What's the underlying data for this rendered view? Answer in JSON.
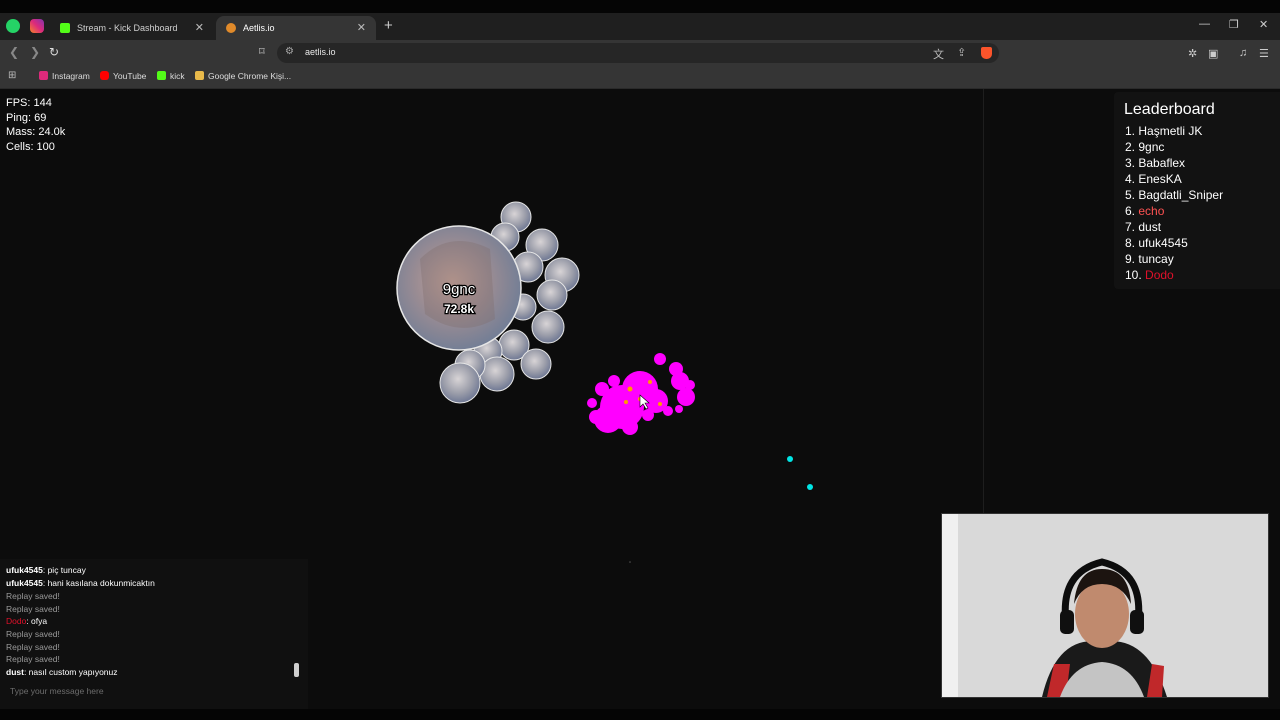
{
  "browser": {
    "tabs": [
      {
        "title": "Stream - Kick Dashboard"
      },
      {
        "title": "Aetlis.io"
      }
    ],
    "url": "aetlis.io",
    "bookmarks": [
      {
        "label": "Instagram"
      },
      {
        "label": "YouTube"
      },
      {
        "label": "kick"
      },
      {
        "label": "Google Chrome Kişi..."
      }
    ]
  },
  "stats": {
    "fps": "FPS: 144",
    "ping": "Ping: 69",
    "mass": "Mass: 24.0k",
    "cells": "Cells: 100"
  },
  "leaderboard": {
    "title": "Leaderboard",
    "entries": [
      {
        "rank": "1.",
        "name": "Haşmetli JK",
        "color": "#ffffff"
      },
      {
        "rank": "2.",
        "name": "9gnc",
        "color": "#ffffff"
      },
      {
        "rank": "3.",
        "name": "Babaflex",
        "color": "#ffffff"
      },
      {
        "rank": "4.",
        "name": "EnesKA",
        "color": "#ffffff"
      },
      {
        "rank": "5.",
        "name": "Bagdatli_Sniper",
        "color": "#ffffff"
      },
      {
        "rank": "6.",
        "name": "echo",
        "color": "#ff5252"
      },
      {
        "rank": "7.",
        "name": "dust",
        "color": "#ffffff"
      },
      {
        "rank": "8.",
        "name": "ufuk4545",
        "color": "#ffffff"
      },
      {
        "rank": "9.",
        "name": "tuncay",
        "color": "#ffffff"
      },
      {
        "rank": "10.",
        "name": "Dodo",
        "color": "#e0102a"
      }
    ]
  },
  "player_cell": {
    "name": "9gnc",
    "mass": "72.8k"
  },
  "chat": {
    "messages": [
      {
        "user": "ufuk4545",
        "text": ": piç tuncay"
      },
      {
        "user": "ufuk4545",
        "text": ": hani kasılana dokunmicaktın"
      },
      {
        "system": "Replay saved!"
      },
      {
        "system": "Replay saved!"
      },
      {
        "user": "Dodo",
        "text": ": ofya"
      },
      {
        "system": "Replay saved!"
      },
      {
        "system": "Replay saved!"
      },
      {
        "system": "Replay saved!"
      },
      {
        "user": "dust",
        "text": ": nasıl custom yapıyonuz"
      }
    ],
    "placeholder": "Type your message here"
  },
  "colors": {
    "enemy_cells": "#ff00ff",
    "pellets": "#00e5e5",
    "accent_red": "#e0102a"
  }
}
